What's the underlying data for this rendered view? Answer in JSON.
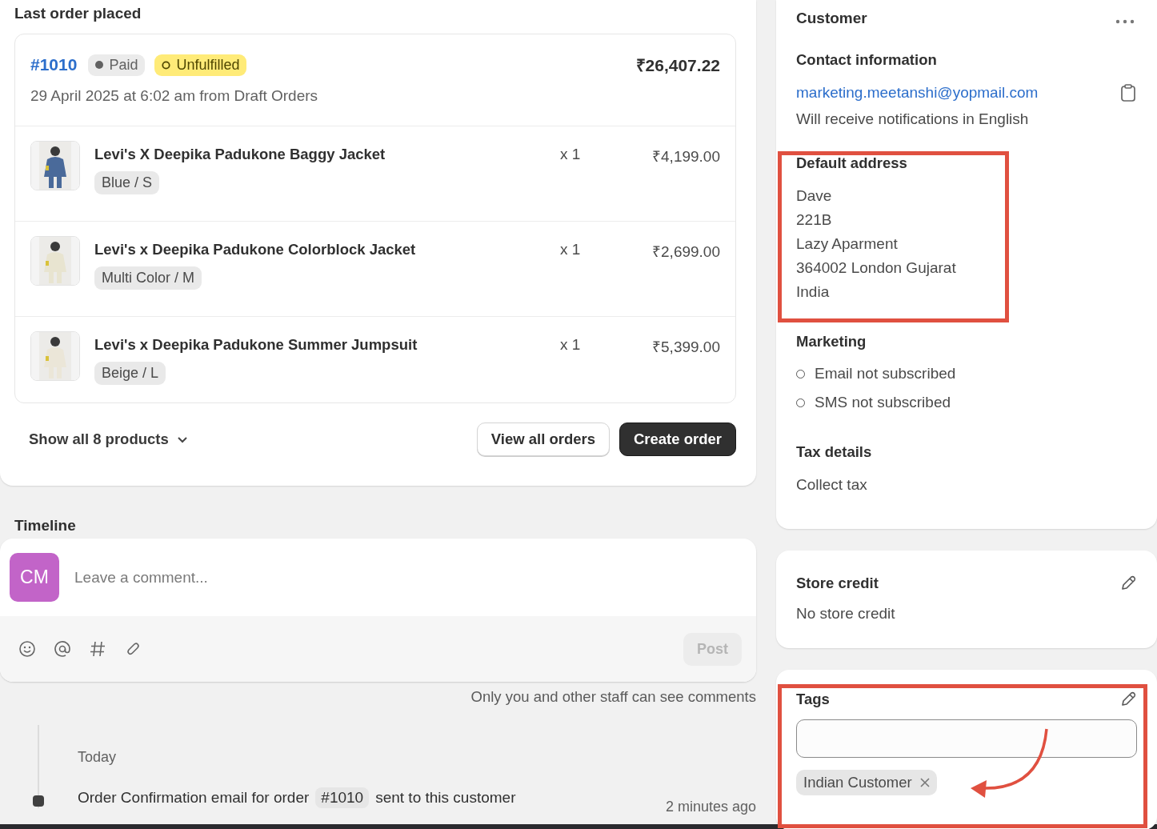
{
  "last_order": {
    "heading": "Last order placed",
    "order_number": "#1010",
    "payment_badge": "Paid",
    "fulfillment_badge": "Unfulfilled",
    "total": "₹26,407.22",
    "date_line": "29 April 2025 at 6:02 am from Draft Orders",
    "items": [
      {
        "name": "Levi's X Deepika Padukone Baggy Jacket",
        "variant": "Blue / S",
        "quantity": "x 1",
        "price": "₹4,199.00"
      },
      {
        "name": "Levi's x Deepika Padukone Colorblock Jacket",
        "variant": "Multi Color / M",
        "quantity": "x 1",
        "price": "₹2,699.00"
      },
      {
        "name": "Levi's x Deepika Padukone Summer Jumpsuit",
        "variant": "Beige / L",
        "quantity": "x 1",
        "price": "₹5,399.00"
      }
    ],
    "show_all": "Show all 8 products",
    "buttons": [
      {
        "label": "View all orders",
        "kind": "secondary"
      },
      {
        "label": "Create order",
        "kind": "primary"
      }
    ]
  },
  "timeline": {
    "heading": "Timeline",
    "avatar_initials": "CM",
    "comment_placeholder": "Leave a comment...",
    "post_button": {
      "label": "Post",
      "disabled": true
    },
    "note": "Only you and other staff can see comments",
    "date_heading": "Today",
    "events": [
      {
        "text_before": "Order Confirmation email for order",
        "order_ref": "#1010",
        "text_after": "sent to this customer",
        "time": "2 minutes ago"
      }
    ]
  },
  "customer": {
    "heading": "Customer",
    "contact_heading": "Contact information",
    "email": "marketing.meetanshi@yopmail.com",
    "notification_note": "Will receive notifications in English",
    "address_heading": "Default address",
    "address_lines": [
      "Dave",
      "221B",
      "Lazy Aparment",
      "364002 London Gujarat",
      "India"
    ],
    "marketing_heading": "Marketing",
    "marketing": [
      {
        "label": "Email not subscribed",
        "subscribed": false
      },
      {
        "label": "SMS not subscribed",
        "subscribed": false
      }
    ],
    "tax_heading": "Tax details",
    "tax_value": "Collect tax"
  },
  "store_credit": {
    "heading": "Store credit",
    "value": "No store credit"
  },
  "tags": {
    "heading": "Tags",
    "tags": [
      {
        "label": "Indian Customer"
      }
    ]
  }
}
